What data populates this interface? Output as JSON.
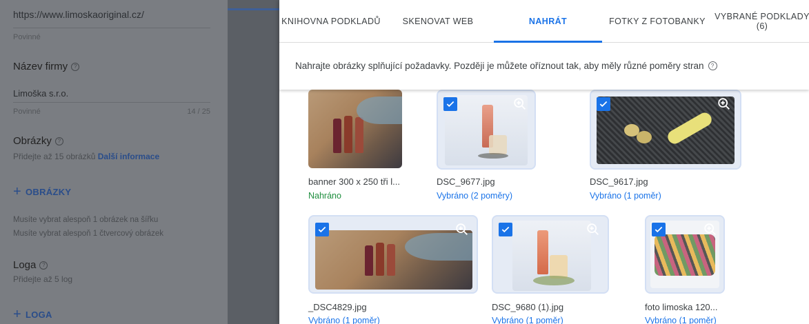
{
  "form": {
    "url_value": "https://www.limoskaoriginal.cz/",
    "url_required": "Povinné",
    "company_title": "Název firmy",
    "company_value": "Limoška s.r.o.",
    "company_required": "Povinné",
    "company_count": "14 / 25",
    "images_title": "Obrázky",
    "images_hint": "Přidejte až 15 obrázků",
    "images_more": "Další informace",
    "images_add": "OBRÁZKY",
    "requirement_1": "Musíte vybrat alespoň 1 obrázek na šířku",
    "requirement_2": "Musíte vybrat alespoň 1 čtvercový obrázek",
    "logos_title": "Loga",
    "logos_hint": "Přidejte až 5 log",
    "logos_add": "LOGA"
  },
  "dialog": {
    "tabs": [
      {
        "label": "KNIHOVNA PODKLADŮ"
      },
      {
        "label": "SKENOVAT WEB"
      },
      {
        "label": "NAHRÁT"
      },
      {
        "label": "FOTKY Z FOTOBANKY"
      },
      {
        "label": "VYBRANÉ PODKLADY",
        "count": "(6)"
      }
    ],
    "active_tab": "NAHRÁT",
    "info": "Nahrajte obrázky splňující požadavky. Později je můžete oříznout tak, aby měly různé poměry stran",
    "items": [
      {
        "name": "banner 300 x 250 tři l...",
        "status": "Nahráno",
        "selected": false
      },
      {
        "name": "DSC_9677.jpg",
        "status": "Vybráno (2 poměry)",
        "selected": true
      },
      {
        "name": "DSC_9617.jpg",
        "status": "Vybráno (1 poměr)",
        "selected": true
      },
      {
        "name": "_DSC4829.jpg",
        "status": "Vybráno (1 poměr)",
        "selected": true
      },
      {
        "name": "DSC_9680 (1).jpg",
        "status": "Vybráno (1 poměr)",
        "selected": true
      },
      {
        "name": "foto limoska 120...",
        "status": "Vybráno (1 poměr)",
        "selected": true
      }
    ]
  },
  "icons": {
    "help": "help-circle-icon",
    "check": "checkbox-checked-icon",
    "zoom": "zoom-in-icon",
    "add": "plus-icon"
  },
  "colors": {
    "accent": "#1a73e8",
    "success": "#1e8e3e",
    "overlay": "#7a7d82"
  }
}
